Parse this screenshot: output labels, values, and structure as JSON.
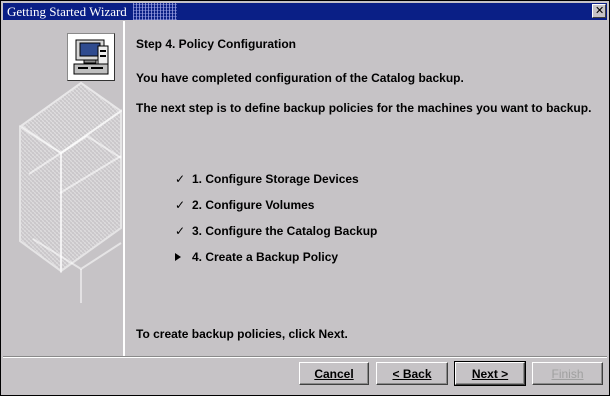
{
  "window": {
    "title": "Getting Started Wizard",
    "title_bar_color": "#0a1f86",
    "background_color": "#c6c3c6",
    "close_icon": "close-icon"
  },
  "wizard": {
    "step_title": "Step 4.  Policy Configuration",
    "completion_text": "You have completed configuration of the Catalog backup.",
    "next_step_text": "The next step is to define backup policies for the machines you want to backup.",
    "footer_text": "To create backup policies, click Next."
  },
  "checklist": [
    {
      "marker": "✓",
      "label": "1.  Configure Storage Devices",
      "state": "completed"
    },
    {
      "marker": "✓",
      "label": "2.  Configure Volumes",
      "state": "completed"
    },
    {
      "marker": "✓",
      "label": "3.  Configure the Catalog Backup",
      "state": "completed"
    },
    {
      "marker": "▶",
      "label": "4.  Create a Backup Policy",
      "state": "current"
    }
  ],
  "buttons": {
    "cancel": "Cancel",
    "back": "< Back",
    "next": "Next >",
    "finish": "Finish"
  },
  "icons": {
    "sidebar_icon": "computer-icon",
    "completed_marker": "check-icon",
    "current_marker": "right-arrow-icon"
  }
}
